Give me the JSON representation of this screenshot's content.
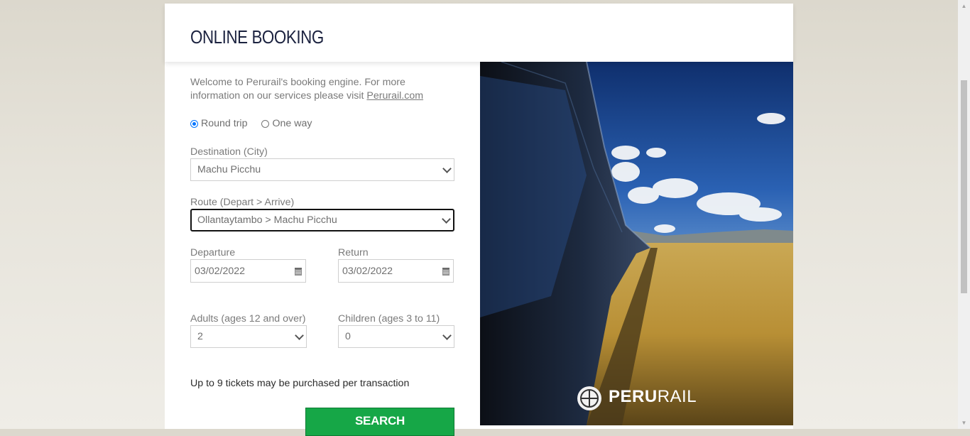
{
  "header": {
    "title": "ONLINE BOOKING"
  },
  "intro": {
    "text": "Welcome to Perurail's booking engine. For more information on our services please visit ",
    "link": "Perurail.com"
  },
  "trip_type": {
    "round_trip": "Round trip",
    "one_way": "One way",
    "selected": "round_trip"
  },
  "destination": {
    "label": "Destination (City)",
    "value": "Machu Picchu"
  },
  "route": {
    "label": "Route (Depart > Arrive)",
    "value": "Ollantaytambo > Machu Picchu"
  },
  "departure": {
    "label": "Departure",
    "value": "03/02/2022"
  },
  "return": {
    "label": "Return",
    "value": "03/02/2022"
  },
  "adults": {
    "label": "Adults (ages 12 and over)",
    "value": "2"
  },
  "children": {
    "label": "Children (ages 3 to 11)",
    "value": "0"
  },
  "note": "Up to 9 tickets may be purchased per transaction",
  "search": {
    "label": "SEARCH"
  },
  "brand": {
    "name_bold": "PERU",
    "name_light": "RAIL"
  },
  "colors": {
    "accent_button": "#16a747",
    "radio_selected": "#0075ff",
    "title": "#1c2340"
  }
}
